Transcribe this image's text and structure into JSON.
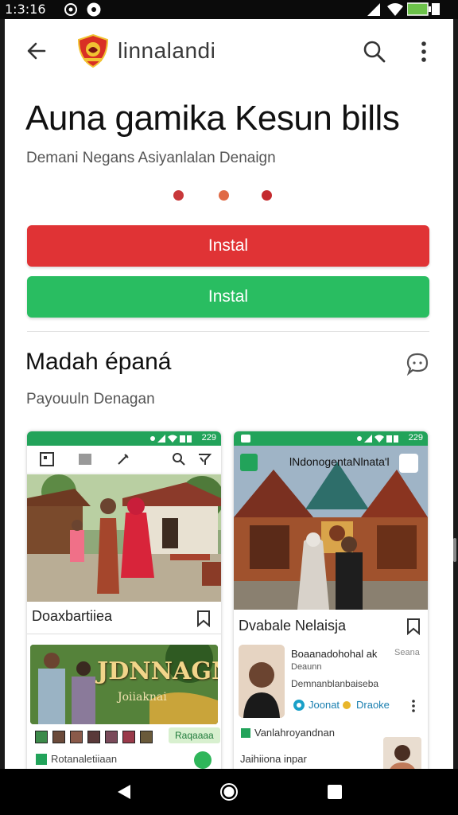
{
  "status_bar": {
    "time": "1:3:16"
  },
  "app_bar": {
    "title": "linnalandi"
  },
  "hero": {
    "headline": "Auna gamika Kesun bills",
    "subline": "Demani Negans Asiyanlalan Denaign"
  },
  "pager_dots": [
    {
      "color": "#c8383a"
    },
    {
      "color": "#e06a45"
    },
    {
      "color": "#c42a2e"
    }
  ],
  "buttons": {
    "install_red": {
      "label": "Instal",
      "color": "#e03335"
    },
    "install_green": {
      "label": "Instal",
      "color": "#29bd61"
    }
  },
  "section": {
    "title": "Madah épaná",
    "subtitle": "Payouuln Denagan"
  },
  "card_left": {
    "status_time": "229",
    "caption": "Doaxbartiiea",
    "banner_title": "JDNNAGN",
    "banner_subtitle": "Joiiaknai",
    "chip_label": "Raqaaaa",
    "footer": "Rotanaletiiaan"
  },
  "card_right": {
    "status_time": "229",
    "overlay_title": "lNdonogentaNlnata'l",
    "caption": "Dvabale Nelaisja",
    "item_title": "Boaanadohohal ak",
    "item_meta": "Seana",
    "item_line2": "Deaunn",
    "item_line3": "Demnanblanbaiseba",
    "tag1": "Joonat",
    "tag2": "Draoke",
    "row_label": "Vanlahroyandnan",
    "footer": "Jaihiiona inpar"
  },
  "colors": {
    "brand_green": "#22a35a",
    "accent_red": "#e03335"
  }
}
